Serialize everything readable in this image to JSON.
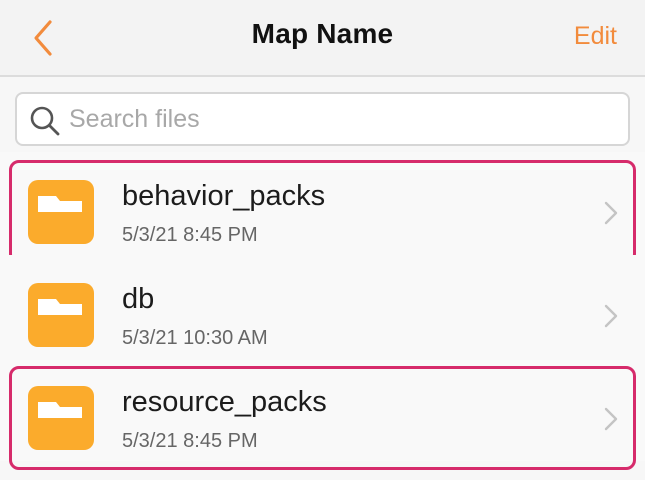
{
  "header": {
    "back_icon": "chevron-left-icon",
    "title": "Map Name",
    "edit_label": "Edit"
  },
  "search": {
    "icon": "search-icon",
    "placeholder": "Search files",
    "value": ""
  },
  "files": [
    {
      "name": "behavior_packs",
      "date": "5/3/21 8:45 PM",
      "icon": "folder-icon",
      "highlighted": true
    },
    {
      "name": "db",
      "date": "5/3/21 10:30 AM",
      "icon": "folder-icon",
      "highlighted": false
    },
    {
      "name": "resource_packs",
      "date": "5/3/21 8:45 PM",
      "icon": "folder-icon",
      "highlighted": true
    }
  ],
  "colors": {
    "accent": "#f28b3c",
    "folder": "#fbab2c",
    "highlight": "#d62b6b"
  }
}
